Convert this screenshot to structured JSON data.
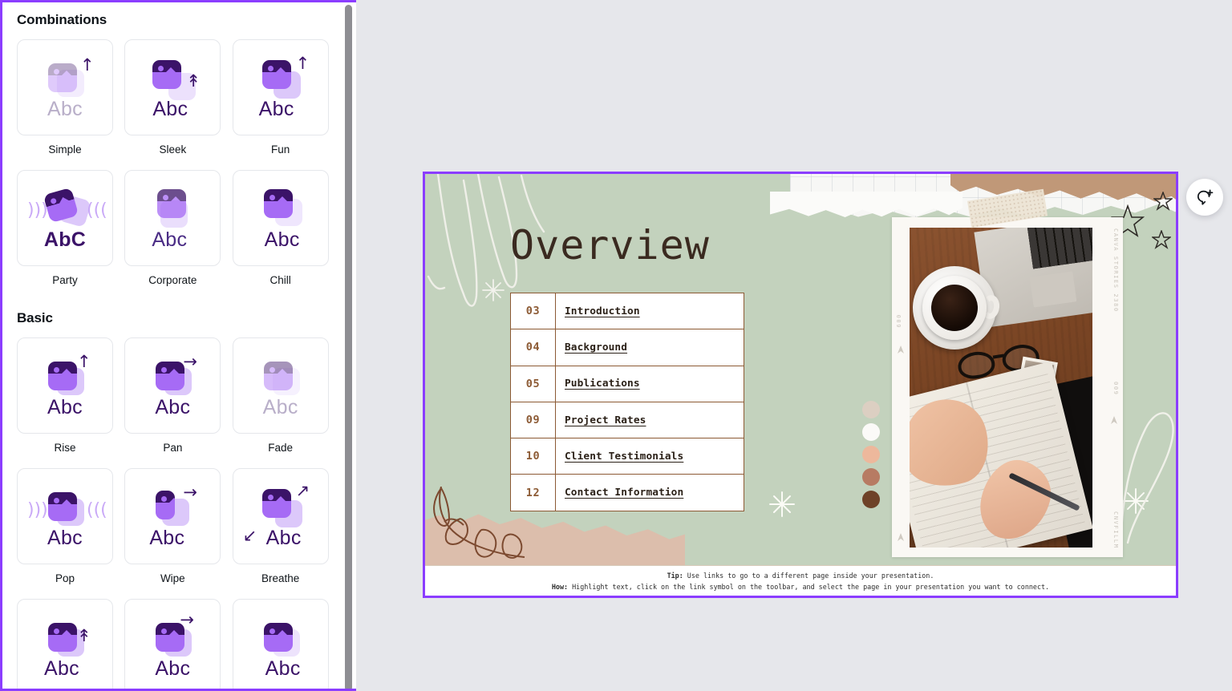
{
  "panel": {
    "sections": [
      {
        "title": "Combinations",
        "items": [
          {
            "label": "Simple",
            "icon": "image-text-rise-icon"
          },
          {
            "label": "Sleek",
            "icon": "image-text-slide-up-icon"
          },
          {
            "label": "Fun",
            "icon": "image-text-bounce-icon"
          },
          {
            "label": "Party",
            "icon": "image-text-shake-icon"
          },
          {
            "label": "Corporate",
            "icon": "image-text-dissolve-icon"
          },
          {
            "label": "Chill",
            "icon": "image-text-drift-icon"
          }
        ]
      },
      {
        "title": "Basic",
        "items": [
          {
            "label": "Rise",
            "icon": "image-text-arrow-up-icon"
          },
          {
            "label": "Pan",
            "icon": "image-text-arrow-right-icon"
          },
          {
            "label": "Fade",
            "icon": "image-text-fade-icon"
          },
          {
            "label": "Pop",
            "icon": "image-text-pop-icon"
          },
          {
            "label": "Wipe",
            "icon": "image-text-wipe-icon"
          },
          {
            "label": "Breathe",
            "icon": "image-text-breathe-icon"
          }
        ]
      },
      {
        "title": "",
        "items": [
          {
            "label": "",
            "icon": "image-text-lift-icon"
          },
          {
            "label": "",
            "icon": "image-text-dash-right-icon"
          },
          {
            "label": "",
            "icon": "image-text-blur-icon"
          }
        ]
      }
    ],
    "abc_text": "Abc",
    "abc_text_party": "AbC"
  },
  "slide": {
    "title": "Overview",
    "toc": {
      "rows": [
        {
          "number": "03",
          "label": "Introduction"
        },
        {
          "number": "04",
          "label": "Background"
        },
        {
          "number": "05",
          "label": "Publications"
        },
        {
          "number": "09",
          "label": "Project Rates"
        },
        {
          "number": "10",
          "label": "Client Testimonials"
        },
        {
          "number": "12",
          "label": "Contact Information"
        }
      ]
    },
    "swatches": [
      "#DCCFC2",
      "#FBFAF8",
      "#EDB89C",
      "#B77B63",
      "#6E4228"
    ],
    "film_labels": {
      "right_top": "CANVA STORIES 2380",
      "right_mid": "009",
      "right_bottom": "CNVFILLM",
      "left_mid": "600"
    },
    "colors": {
      "background": "#C3D2BD",
      "table_border": "#8C5A34",
      "number": "#8C5A34",
      "title": "#3A2A20",
      "selection": "#8B3DFF"
    }
  },
  "tip": {
    "line1_bold": "Tip:",
    "line1_text": " Use links to go to a different page inside your presentation.",
    "line2_bold": "How:",
    "line2_text": " Highlight text, click on the link symbol on the toolbar, and select the page in your presentation  you want to connect."
  },
  "comment_button": {
    "icon": "add-comment-icon",
    "tooltip": "Add comment"
  }
}
